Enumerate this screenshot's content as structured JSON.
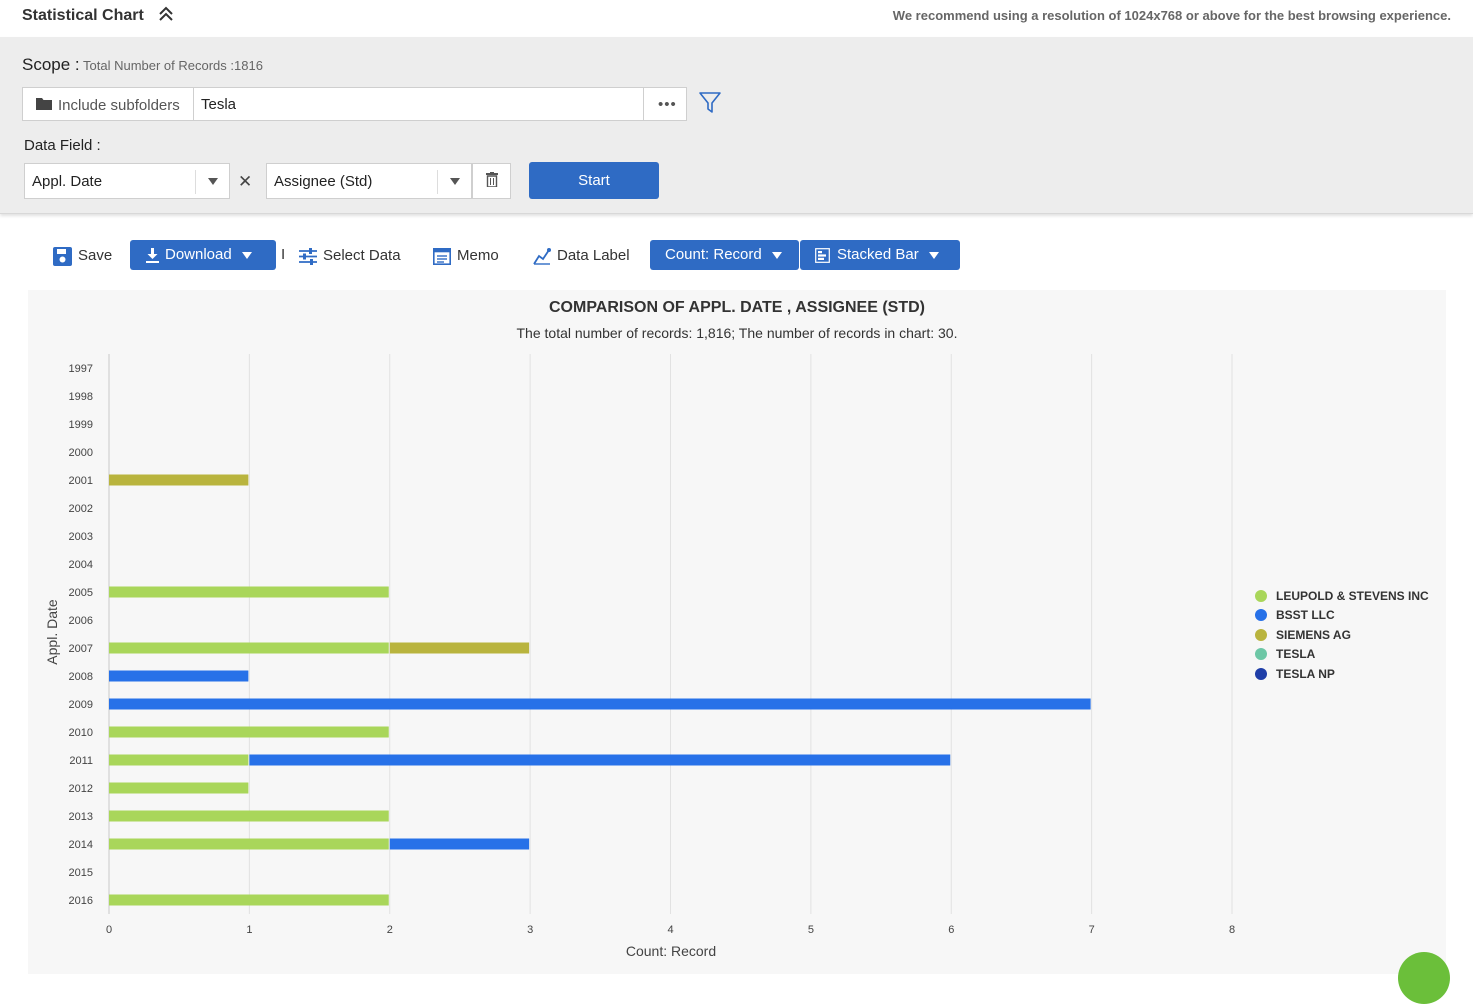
{
  "header": {
    "title": "Statistical Chart",
    "notice": "We recommend using a resolution of 1024x768 or above for the best browsing experience."
  },
  "scope": {
    "label": "Scope :",
    "count_text": "Total Number of Records :1816",
    "subfolders_label": "Include subfolders",
    "query": "Tesla"
  },
  "data_field": {
    "label": "Data Field :",
    "field1": "Appl. Date",
    "field2": "Assignee (Std)",
    "start_label": "Start"
  },
  "toolbar": {
    "save": "Save",
    "download": "Download",
    "separator": "I",
    "select_data": "Select Data",
    "memo": "Memo",
    "data_label": "Data Label",
    "count": "Count: Record",
    "chart_type": "Stacked Bar"
  },
  "colors": {
    "primary": "#2f6bc4",
    "series": [
      "#a9d65a",
      "#2771e8",
      "#b9b43e",
      "#6dc7a6",
      "#1f3ea8"
    ]
  },
  "chart_data": {
    "type": "bar",
    "orientation": "horizontal",
    "stacked": true,
    "title": "COMPARISON OF APPL. DATE , ASSIGNEE (STD)",
    "subtitle": "The total number of records: 1,816; The number of records in chart: 30.",
    "xlabel": "Count: Record",
    "ylabel": "Appl. Date",
    "xlim": [
      0,
      8
    ],
    "xticks": [
      "0",
      "1",
      "2",
      "3",
      "4",
      "5",
      "6",
      "7",
      "8"
    ],
    "grid": true,
    "legend_position": "right",
    "categories": [
      "1997",
      "1998",
      "1999",
      "2000",
      "2001",
      "2002",
      "2003",
      "2004",
      "2005",
      "2006",
      "2007",
      "2008",
      "2009",
      "2010",
      "2011",
      "2012",
      "2013",
      "2014",
      "2015",
      "2016"
    ],
    "series": [
      {
        "name": "LEUPOLD & STEVENS INC",
        "color": "#a9d65a",
        "values": [
          0,
          0,
          0,
          0,
          0,
          0,
          0,
          0,
          2,
          0,
          2,
          0,
          0,
          2,
          1,
          1,
          2,
          2,
          0,
          2
        ]
      },
      {
        "name": "BSST LLC",
        "color": "#2771e8",
        "values": [
          0,
          0,
          0,
          0,
          0,
          0,
          0,
          0,
          0,
          0,
          0,
          1,
          7,
          0,
          5,
          0,
          0,
          1,
          0,
          0
        ]
      },
      {
        "name": "SIEMENS AG",
        "color": "#b9b43e",
        "values": [
          0,
          0,
          0,
          0,
          1,
          0,
          0,
          0,
          0,
          0,
          1,
          0,
          0,
          0,
          0,
          0,
          0,
          0,
          0,
          0
        ]
      },
      {
        "name": "TESLA",
        "color": "#6dc7a6",
        "values": [
          0,
          0,
          0,
          0,
          0,
          0,
          0,
          0,
          0,
          0,
          0,
          0,
          0,
          0,
          0,
          0,
          0,
          0,
          0,
          0
        ]
      },
      {
        "name": "TESLA NP",
        "color": "#1f3ea8",
        "values": [
          0,
          0,
          0,
          0,
          0,
          0,
          0,
          0,
          0,
          0,
          0,
          0,
          0,
          0,
          0,
          0,
          0,
          0,
          0,
          0
        ]
      }
    ]
  }
}
